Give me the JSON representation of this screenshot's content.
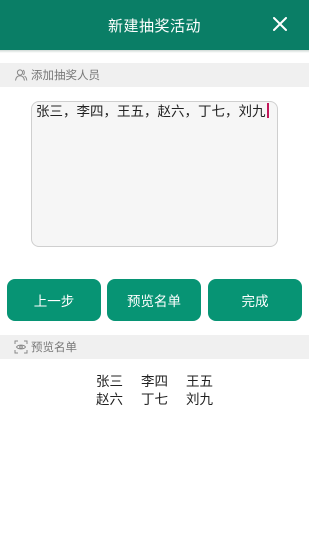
{
  "header": {
    "title": "新建抽奖活动",
    "close_icon": "close-icon"
  },
  "add_section": {
    "label": "添加抽奖人员",
    "icon": "users-icon"
  },
  "names_input": {
    "value": "张三，李四，王五，赵六，丁七，刘九"
  },
  "buttons": {
    "prev_label": "上一步",
    "preview_label": "预览名单",
    "done_label": "完成"
  },
  "preview_section": {
    "label": "预览名单",
    "icon": "eye-scan-icon"
  },
  "preview_rows": [
    [
      "张三",
      "李四",
      "王五"
    ],
    [
      "赵六",
      "丁七",
      "刘九"
    ]
  ],
  "colors": {
    "header": "#0a7e66",
    "button": "#079474",
    "caret": "#c2185b"
  }
}
